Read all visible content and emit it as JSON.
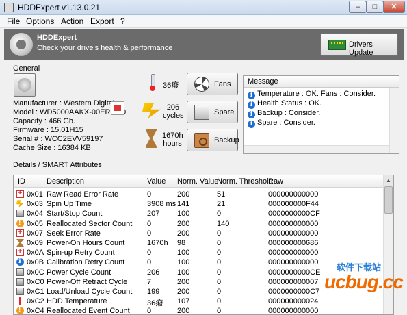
{
  "window": {
    "title": "HDDExpert v1.13.0.21"
  },
  "menu": [
    "File",
    "Options",
    "Action",
    "Export",
    "?"
  ],
  "banner": {
    "app_name": "HDDExpert",
    "tagline": "Check your drive's health & performance",
    "driver_button": "Drivers Update"
  },
  "general": {
    "label": "General",
    "info": [
      "Manufacturer : Western Digital",
      "Model : WD5000AAKX-00ERMA0",
      "Capacity : 466 Gb.",
      "Firmware : 15.01H15",
      "Serial # : WCC2EVV59197",
      "Cache Size : 16384 KB"
    ]
  },
  "stats": {
    "temperature": "36癈",
    "cycles_value": "206",
    "cycles_unit": "cycles",
    "hours_value": "1670h",
    "hours_unit": "hours"
  },
  "buttons": {
    "fans": "Fans",
    "spare": "Spare",
    "backup": "Backup"
  },
  "messages": {
    "header": "Message",
    "items": [
      "Temperature : OK. Fans : Consider.",
      "Health Status : OK.",
      "Backup : Consider.",
      "Spare : Consider."
    ]
  },
  "smart": {
    "label": "Details / SMART Attributes",
    "columns": [
      "ID",
      "Description",
      "Value",
      "Norm. Value",
      "Norm. Threshold",
      "Raw"
    ],
    "rows": [
      {
        "icon": "red-cross",
        "id": "0x01",
        "desc": "Raw Read Error Rate",
        "value": "0",
        "norm": "200",
        "thr": "51",
        "raw": "000000000000"
      },
      {
        "icon": "bolt",
        "id": "0x03",
        "desc": "Spin Up Time",
        "value": "3908 ms",
        "norm": "141",
        "thr": "21",
        "raw": "000000000F44"
      },
      {
        "icon": "disk",
        "id": "0x04",
        "desc": "Start/Stop Count",
        "value": "207",
        "norm": "100",
        "thr": "0",
        "raw": "0000000000CF"
      },
      {
        "icon": "warning",
        "id": "0x05",
        "desc": "Reallocated Sector Count",
        "value": "0",
        "norm": "200",
        "thr": "140",
        "raw": "000000000000"
      },
      {
        "icon": "red-cross",
        "id": "0x07",
        "desc": "Seek Error Rate",
        "value": "0",
        "norm": "200",
        "thr": "0",
        "raw": "000000000000"
      },
      {
        "icon": "hourglass",
        "id": "0x09",
        "desc": "Power-On Hours Count",
        "value": "1670h",
        "norm": "98",
        "thr": "0",
        "raw": "000000000686"
      },
      {
        "icon": "red-cross",
        "id": "0x0A",
        "desc": "Spin-up Retry Count",
        "value": "0",
        "norm": "100",
        "thr": "0",
        "raw": "000000000000"
      },
      {
        "icon": "info",
        "id": "0x0B",
        "desc": "Calibration Retry Count",
        "value": "0",
        "norm": "100",
        "thr": "0",
        "raw": "000000000000"
      },
      {
        "icon": "disk",
        "id": "0x0C",
        "desc": "Power Cycle Count",
        "value": "206",
        "norm": "100",
        "thr": "0",
        "raw": "0000000000CE"
      },
      {
        "icon": "disk",
        "id": "0xC0",
        "desc": "Power-Off Retract Cycle",
        "value": "7",
        "norm": "200",
        "thr": "0",
        "raw": "000000000007"
      },
      {
        "icon": "disk",
        "id": "0xC1",
        "desc": "Load/Unload Cycle Count",
        "value": "199",
        "norm": "200",
        "thr": "0",
        "raw": "0000000000C7"
      },
      {
        "icon": "thermometer",
        "id": "0xC2",
        "desc": "HDD Temperature",
        "value": "36癈",
        "norm": "107",
        "thr": "0",
        "raw": "000000000024"
      },
      {
        "icon": "warning",
        "id": "0xC4",
        "desc": "Reallocated Event Count",
        "value": "0",
        "norm": "200",
        "thr": "0",
        "raw": "000000000000"
      }
    ]
  },
  "watermark": {
    "top": "软件下载站",
    "bottom": "ucbug.cc"
  }
}
